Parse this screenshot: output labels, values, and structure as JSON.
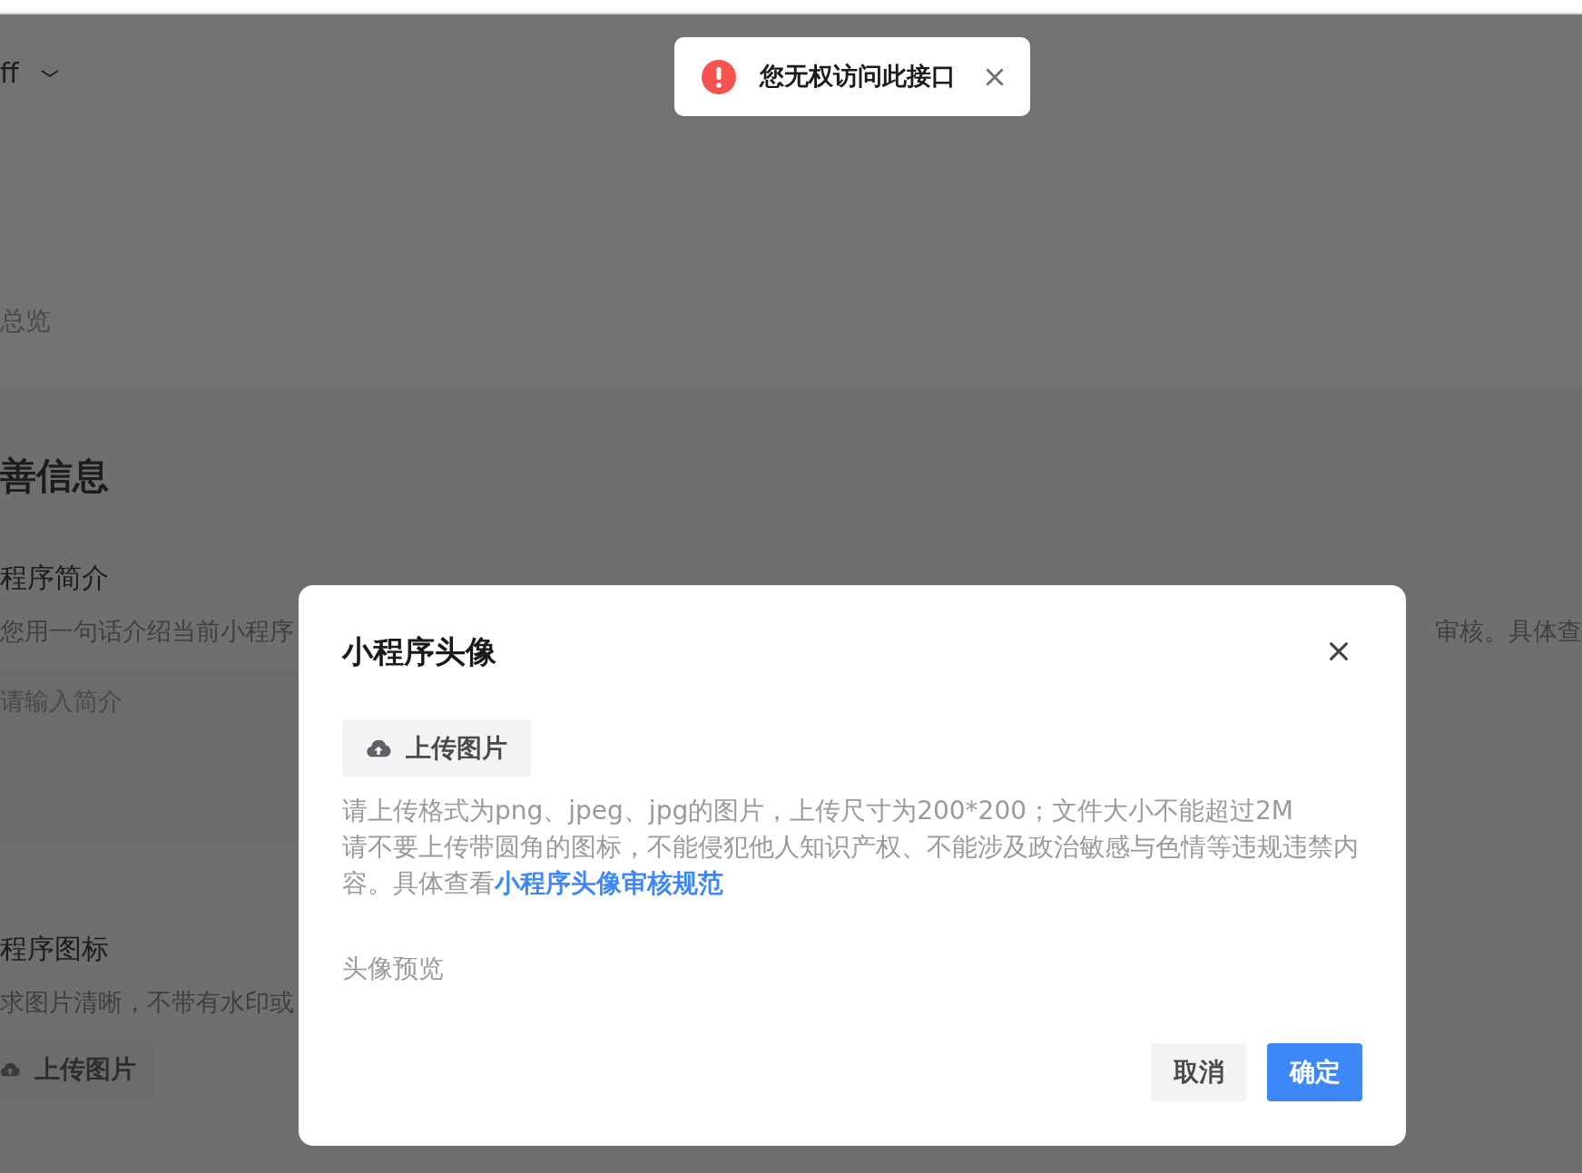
{
  "page": {
    "account_menu": {
      "label": "ff"
    },
    "breadcrumb": "总览",
    "section_title": "善信息",
    "intro": {
      "label": "程序简介",
      "hint": "您用一句话介绍当前小程序",
      "hint_right": "审核。具体查",
      "placeholder": "请输入简介"
    },
    "icon": {
      "label": "程序图标",
      "hint": "求图片清晰，不带有水印或",
      "upload_button": "上传图片"
    }
  },
  "toast": {
    "kind": "error",
    "message": "您无权访问此接口"
  },
  "dialog": {
    "title": "小程序头像",
    "upload_button": "上传图片",
    "hints": [
      "请上传格式为png、jpeg、jpg的图片，上传尺寸为200*200；文件大小不能超过2M",
      "请不要上传带圆角的图标，不能侵犯他人知识产权、不能涉及政治敏感与色情等违规违禁内容。具体查看"
    ],
    "guideline_link": "小程序头像审核规范",
    "preview_label": "头像预览",
    "buttons": [
      {
        "label": "取消",
        "kind": "secondary"
      },
      {
        "label": "确定",
        "kind": "primary"
      }
    ]
  }
}
